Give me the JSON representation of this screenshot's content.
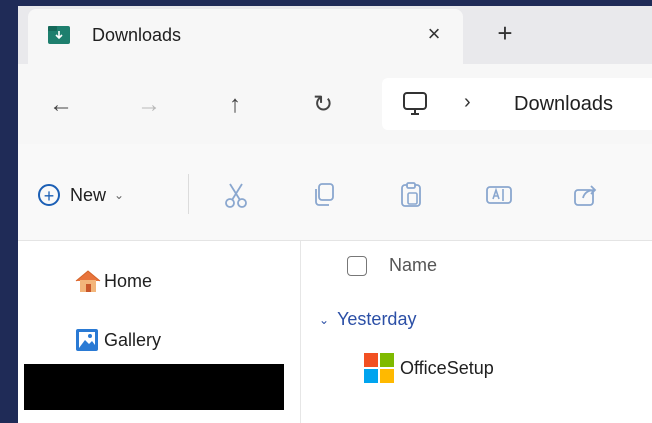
{
  "tab": {
    "title": "Downloads",
    "close_glyph": "×",
    "new_tab_glyph": "+"
  },
  "nav": {
    "back_glyph": "←",
    "forward_glyph": "→",
    "up_glyph": "↑",
    "refresh_glyph": "↻",
    "breadcrumb_sep": "›",
    "crumb": "Downloads"
  },
  "toolbar": {
    "new_label": "New",
    "new_plus": "+",
    "new_caret": "⌄",
    "icons": [
      "cut-icon",
      "copy-icon",
      "paste-icon",
      "rename-icon",
      "share-icon"
    ]
  },
  "sidebar": {
    "items": [
      {
        "label": "Home",
        "icon": "home-icon"
      },
      {
        "label": "Gallery",
        "icon": "gallery-icon"
      }
    ]
  },
  "list": {
    "column_name": "Name",
    "group_chevron": "⌄",
    "group_label": "Yesterday",
    "files": [
      {
        "name": "OfficeSetup",
        "icon": "microsoft-logo-icon"
      }
    ]
  },
  "colors": {
    "accent": "#1b5fb5",
    "group_text": "#2b4fa6",
    "ms_red": "#f25022",
    "ms_green": "#7fba00",
    "ms_blue": "#00a4ef",
    "ms_yellow": "#ffb900"
  }
}
